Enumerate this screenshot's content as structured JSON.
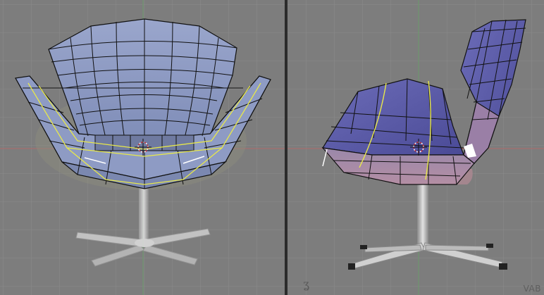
{
  "viewports": [
    {
      "id": "front",
      "view": "front",
      "grid": true,
      "mesh_color": "#8a97c0"
    },
    {
      "id": "side",
      "view": "side",
      "grid": true,
      "mesh_color": "#5b5aa8",
      "corner_text": "VAB"
    }
  ],
  "colors": {
    "background": "#7d7d7d",
    "grid": "#8b8b8b",
    "axis_red": "#b06a6a",
    "axis_green": "#6a9a6a",
    "wire": "#111111",
    "selected_edge": "#e8e84a",
    "cursor": "#cc2222"
  },
  "icons": [
    "3d-cursor-icon",
    "axis-orientation-icon"
  ]
}
